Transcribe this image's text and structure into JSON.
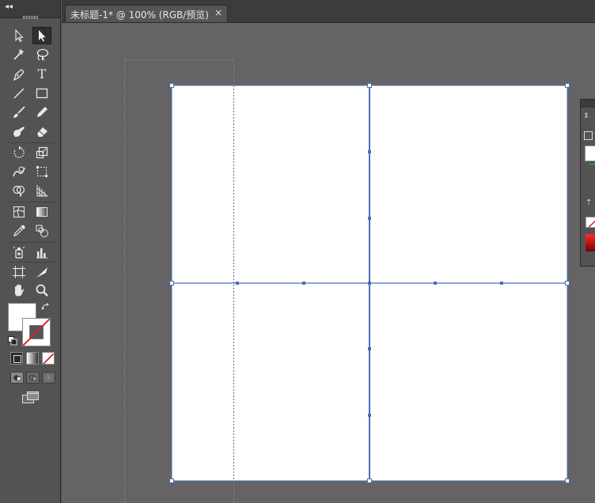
{
  "document": {
    "tab_title": "未标题-1* @ 100% (RGB/预览)",
    "close_glyph": "×"
  },
  "toolbar": {
    "collapse_glyph": "◂◂",
    "text_tool_glyph": "T",
    "tools": [
      {
        "id": "selection-tool",
        "icon": "arrow-icon"
      },
      {
        "id": "direct-selection-tool",
        "icon": "direct-arrow-icon",
        "active": true
      },
      {
        "id": "magic-wand-tool",
        "icon": "magic-wand-icon"
      },
      {
        "id": "lasso-tool",
        "icon": "lasso-icon"
      },
      {
        "id": "pen-tool",
        "icon": "pen-icon"
      },
      {
        "id": "type-tool",
        "icon": "type-icon"
      },
      {
        "id": "line-segment-tool",
        "icon": "line-icon"
      },
      {
        "id": "rectangle-tool",
        "icon": "rectangle-icon"
      },
      {
        "id": "paintbrush-tool",
        "icon": "brush-icon"
      },
      {
        "id": "pencil-tool",
        "icon": "pencil-icon"
      },
      {
        "id": "blob-brush-tool",
        "icon": "blob-brush-icon"
      },
      {
        "id": "eraser-tool",
        "icon": "eraser-icon"
      },
      {
        "id": "rotate-tool",
        "icon": "rotate-icon"
      },
      {
        "id": "scale-tool",
        "icon": "scale-icon"
      },
      {
        "id": "warp-tool",
        "icon": "warp-icon"
      },
      {
        "id": "free-transform-tool",
        "icon": "free-transform-icon"
      },
      {
        "id": "shape-builder-tool",
        "icon": "shape-builder-icon"
      },
      {
        "id": "perspective-grid-tool",
        "icon": "perspective-grid-icon"
      },
      {
        "id": "mesh-tool",
        "icon": "mesh-icon"
      },
      {
        "id": "gradient-tool",
        "icon": "gradient-icon"
      },
      {
        "id": "eyedropper-tool",
        "icon": "eyedropper-icon"
      },
      {
        "id": "blend-tool",
        "icon": "blend-icon"
      },
      {
        "id": "symbol-sprayer-tool",
        "icon": "symbol-sprayer-icon"
      },
      {
        "id": "column-graph-tool",
        "icon": "column-graph-icon"
      },
      {
        "id": "artboard-tool",
        "icon": "artboard-icon"
      },
      {
        "id": "slice-tool",
        "icon": "slice-icon"
      },
      {
        "id": "hand-tool",
        "icon": "hand-icon"
      },
      {
        "id": "zoom-tool",
        "icon": "zoom-icon"
      }
    ]
  },
  "colors": {
    "fill": "#ffffff",
    "stroke": "#ffffff",
    "canvas_bg": "#656366",
    "artboard": "#ffffff",
    "selection_blue": "#4a6fb5",
    "none_red": "#d0262b"
  }
}
